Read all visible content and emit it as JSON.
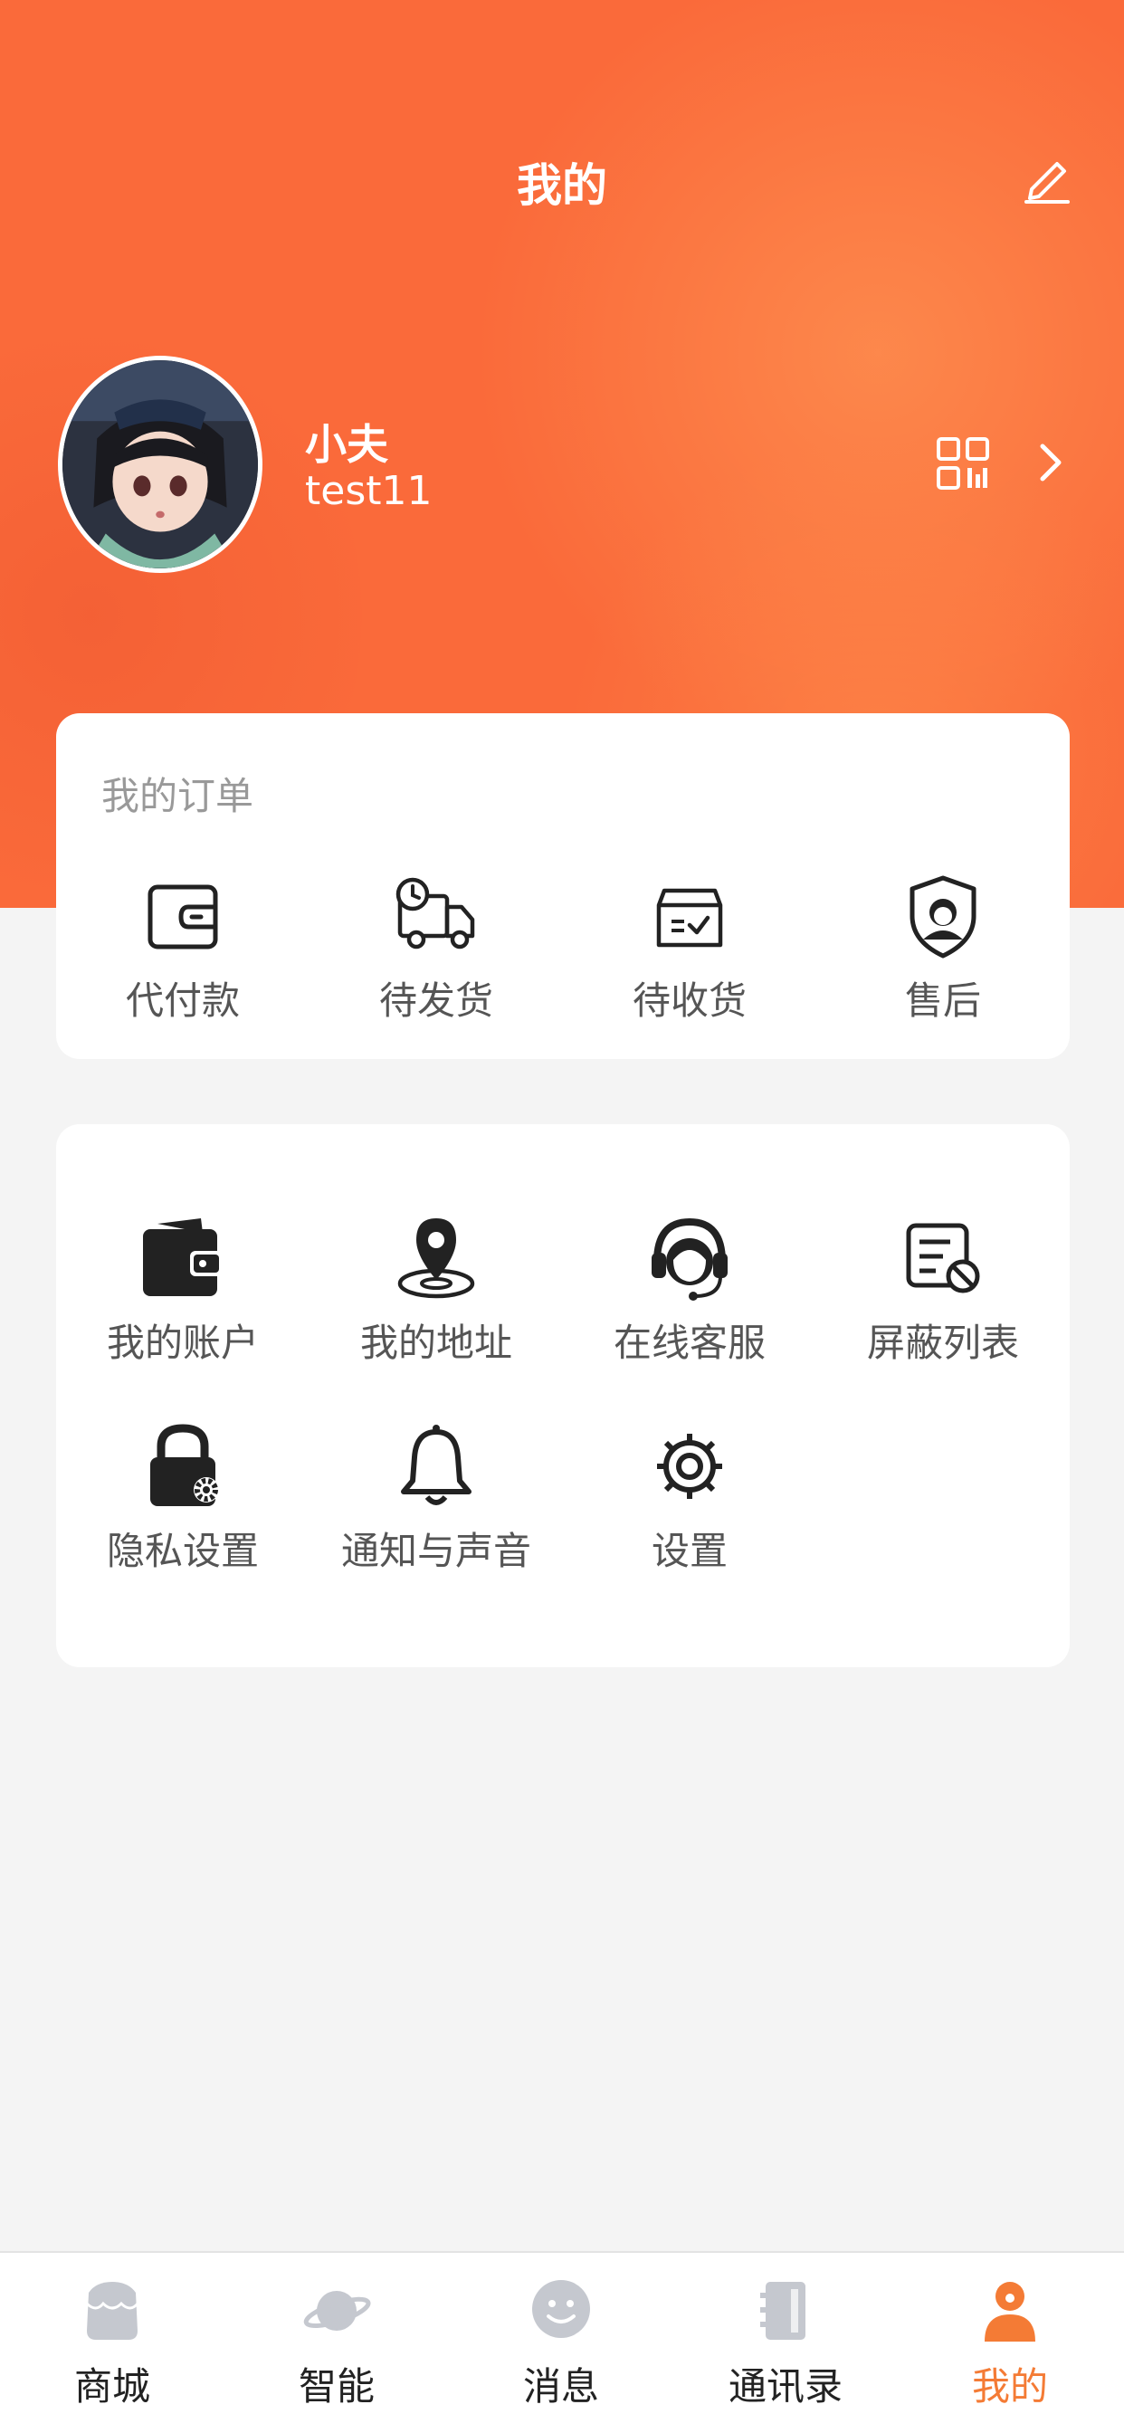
{
  "header": {
    "title": "我的"
  },
  "profile": {
    "name": "小夫",
    "id": "test11"
  },
  "orders": {
    "title": "我的订单",
    "items": [
      {
        "label": "代付款",
        "icon": "wallet-icon"
      },
      {
        "label": "待发货",
        "icon": "delivery-truck-icon"
      },
      {
        "label": "待收货",
        "icon": "package-box-icon"
      },
      {
        "label": "售后",
        "icon": "service-shield-icon"
      }
    ]
  },
  "services": {
    "items": [
      {
        "label": "我的账户",
        "icon": "account-wallet-icon"
      },
      {
        "label": "我的地址",
        "icon": "location-pin-icon"
      },
      {
        "label": "在线客服",
        "icon": "headset-icon"
      },
      {
        "label": "屏蔽列表",
        "icon": "block-list-icon"
      },
      {
        "label": "隐私设置",
        "icon": "privacy-lock-icon"
      },
      {
        "label": "通知与声音",
        "icon": "bell-icon"
      },
      {
        "label": "设置",
        "icon": "gear-icon"
      }
    ]
  },
  "tabbar": {
    "items": [
      {
        "label": "商城",
        "icon": "shop-icon"
      },
      {
        "label": "智能",
        "icon": "planet-icon"
      },
      {
        "label": "消息",
        "icon": "message-smile-icon"
      },
      {
        "label": "通讯录",
        "icon": "contacts-book-icon"
      },
      {
        "label": "我的",
        "icon": "user-icon"
      }
    ],
    "active": "我的"
  },
  "colors": {
    "accent": "#fa6a3a",
    "active_tab": "#f47b35",
    "inactive_tab_icon": "#c5c8cf"
  }
}
